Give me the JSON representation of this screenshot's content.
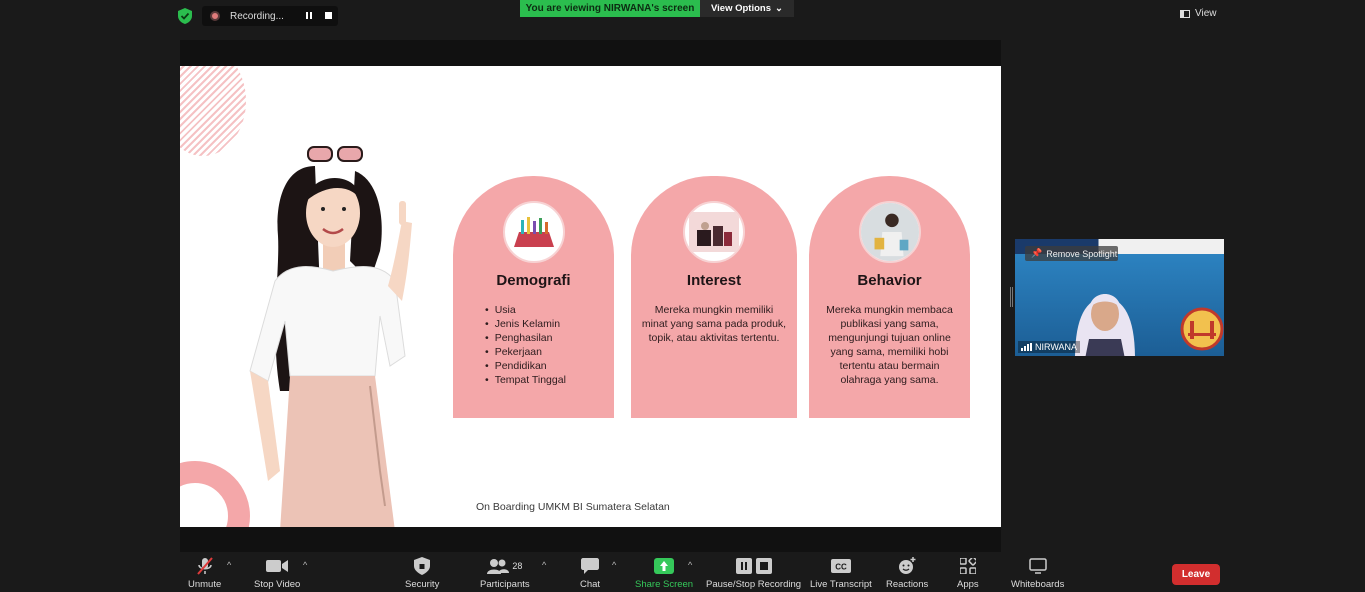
{
  "top": {
    "recording_label": "Recording...",
    "viewing_banner": "You are viewing NIRWANA's screen",
    "view_options_label": "View Options",
    "view_label": "View"
  },
  "slide": {
    "cards": [
      {
        "title": "Demografi",
        "items": [
          "Usia",
          "Jenis Kelamin",
          "Penghasilan",
          "Pekerjaan",
          "Pendidikan",
          "Tempat Tinggal"
        ]
      },
      {
        "title": "Interest",
        "body": "Mereka mungkin memiliki minat yang sama pada produk, topik, atau aktivitas tertentu."
      },
      {
        "title": "Behavior",
        "body": "Mereka mungkin membaca publikasi yang sama, mengunjungi tujuan online yang sama, memiliki hobi tertentu atau bermain olahraga yang sama."
      }
    ],
    "footer": "On Boarding UMKM BI Sumatera Selatan"
  },
  "participant": {
    "remove_spotlight": "Remove Spotlight",
    "name": "NIRWANA"
  },
  "toolbar": {
    "unmute": "Unmute",
    "stop_video": "Stop Video",
    "security": "Security",
    "participants": "Participants",
    "participants_count": "28",
    "chat": "Chat",
    "share_screen": "Share Screen",
    "pause_stop_recording": "Pause/Stop Recording",
    "live_transcript": "Live Transcript",
    "reactions": "Reactions",
    "apps": "Apps",
    "whiteboards": "Whiteboards",
    "leave": "Leave"
  },
  "colors": {
    "accent_green": "#2bbd4e",
    "card_pink": "#f4a7a9",
    "leave_red": "#d22e2e"
  }
}
